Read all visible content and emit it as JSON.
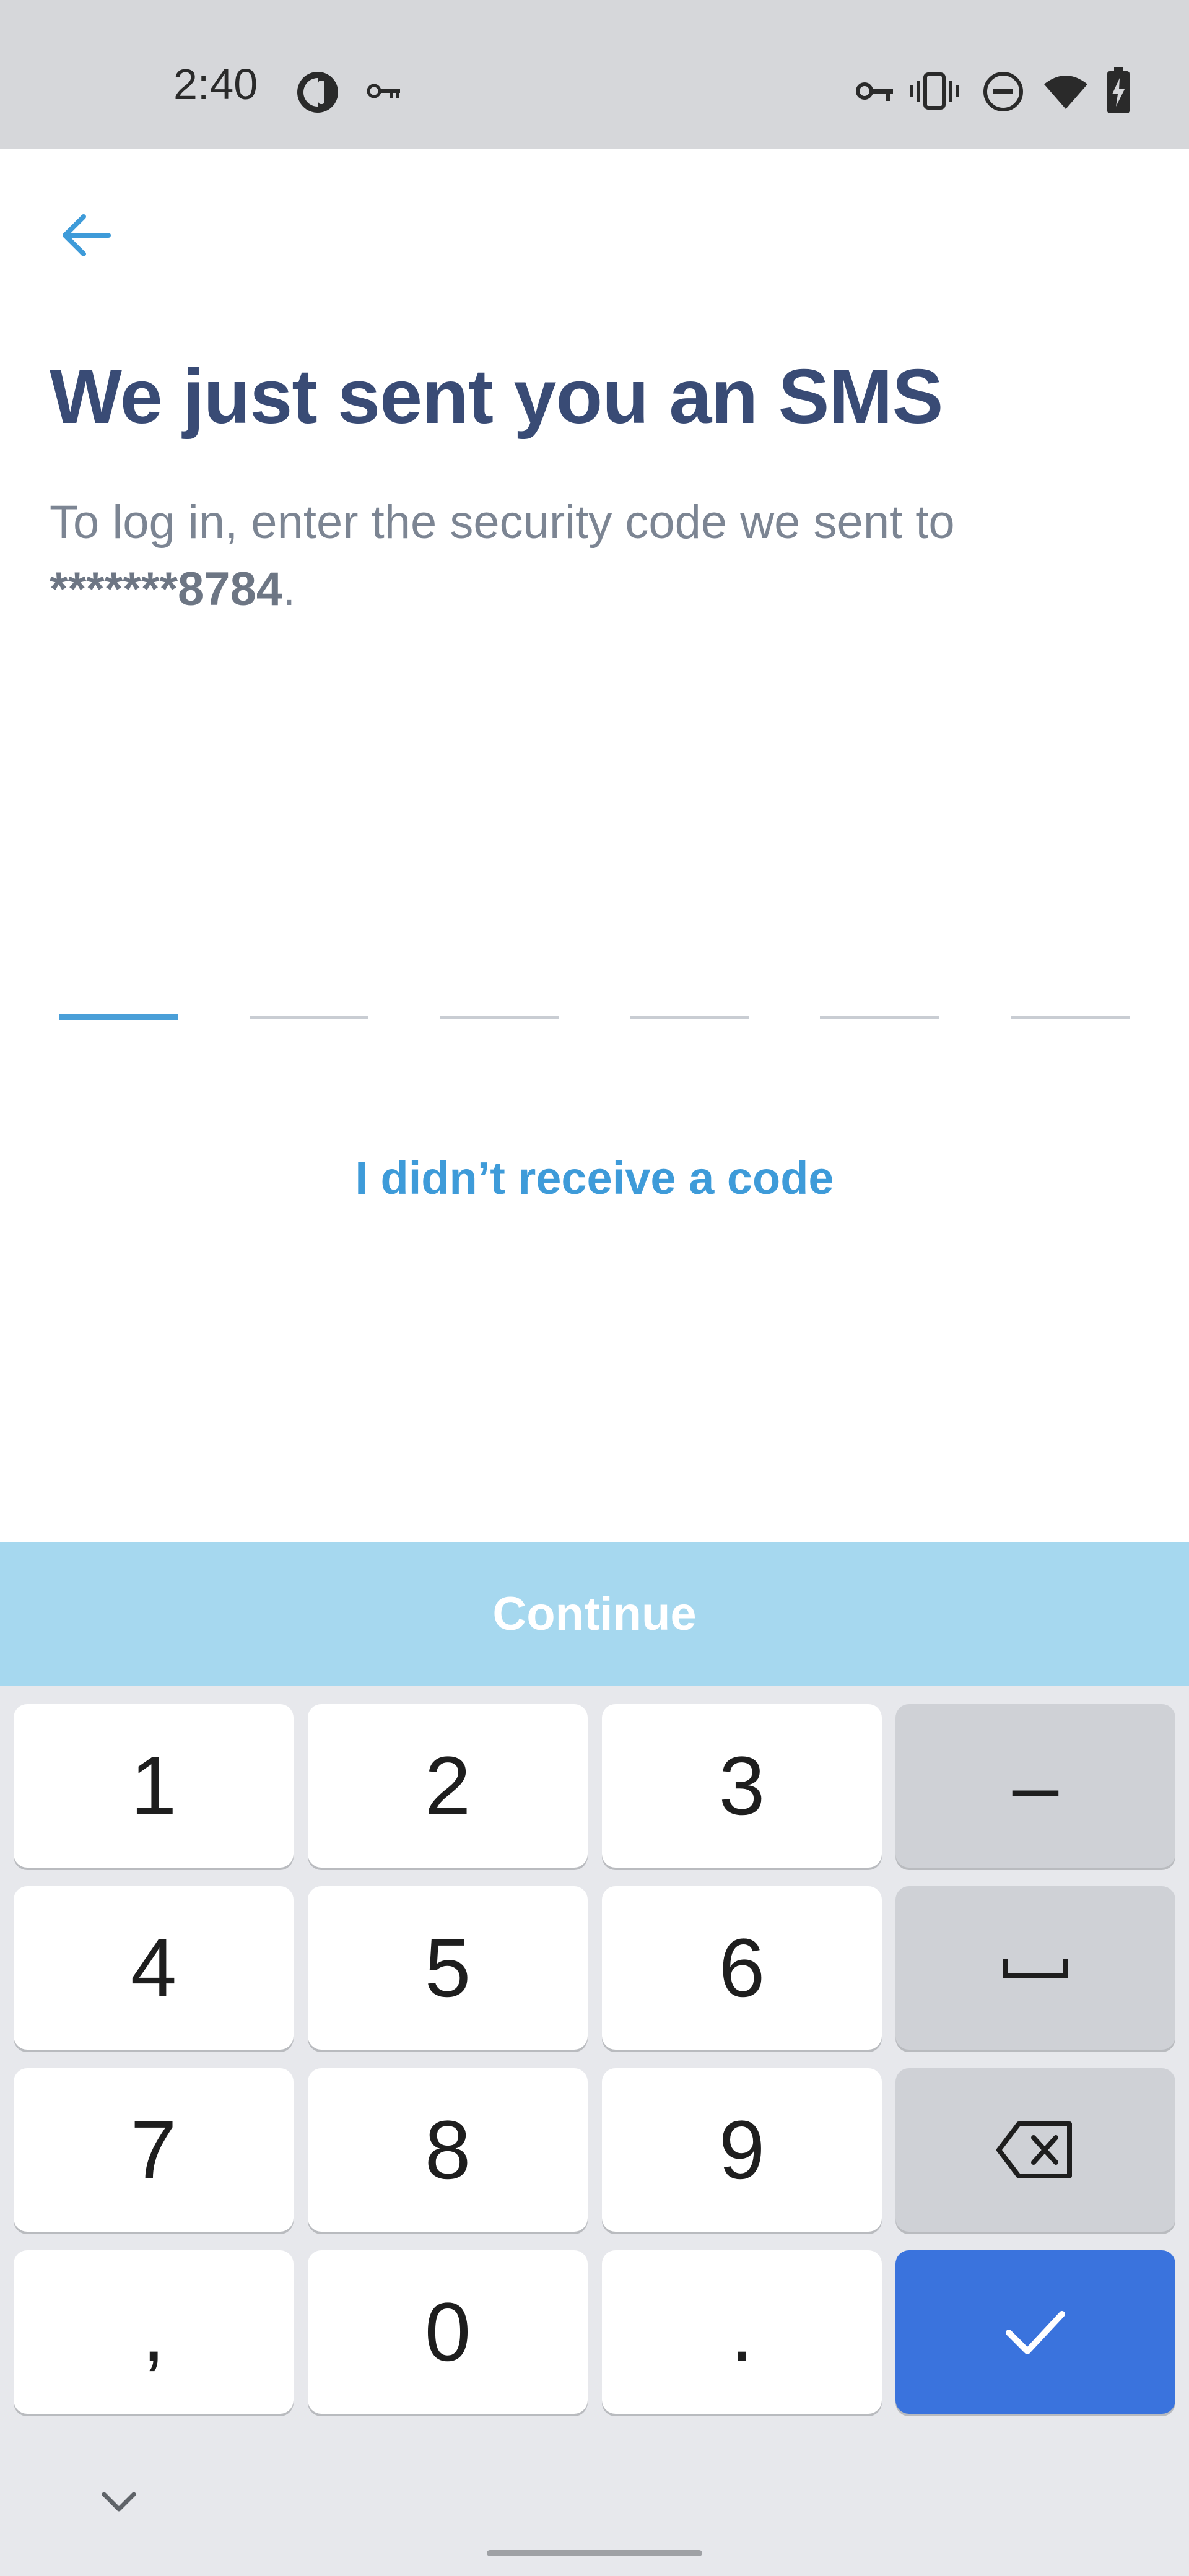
{
  "status_bar": {
    "time": "2:40",
    "icons": [
      "app-notification-icon",
      "key-icon",
      "vpn-key-icon",
      "vibrate-icon",
      "do-not-disturb-icon",
      "wifi-icon",
      "battery-charging-icon"
    ]
  },
  "header": {
    "back_icon": "arrow-left-icon",
    "title": "We just sent you an SMS",
    "subtitle_prefix": "To log in, enter the security code we sent to ",
    "masked_phone": "*******8784",
    "subtitle_suffix": "."
  },
  "code_input": {
    "digits": 6,
    "active_index": 0
  },
  "resend_link": "I didn’t receive a code",
  "continue_button": "Continue",
  "keyboard": {
    "rows": [
      [
        "1",
        "2",
        "3",
        "–"
      ],
      [
        "4",
        "5",
        "6",
        "space"
      ],
      [
        "7",
        "8",
        "9",
        "backspace"
      ],
      [
        ",",
        "0",
        ".",
        "enter"
      ]
    ]
  },
  "colors": {
    "title": "#394b75",
    "accent": "#3e9bd9",
    "continue_disabled": "#a6d8ef",
    "keyboard_enter": "#3a73dd"
  }
}
